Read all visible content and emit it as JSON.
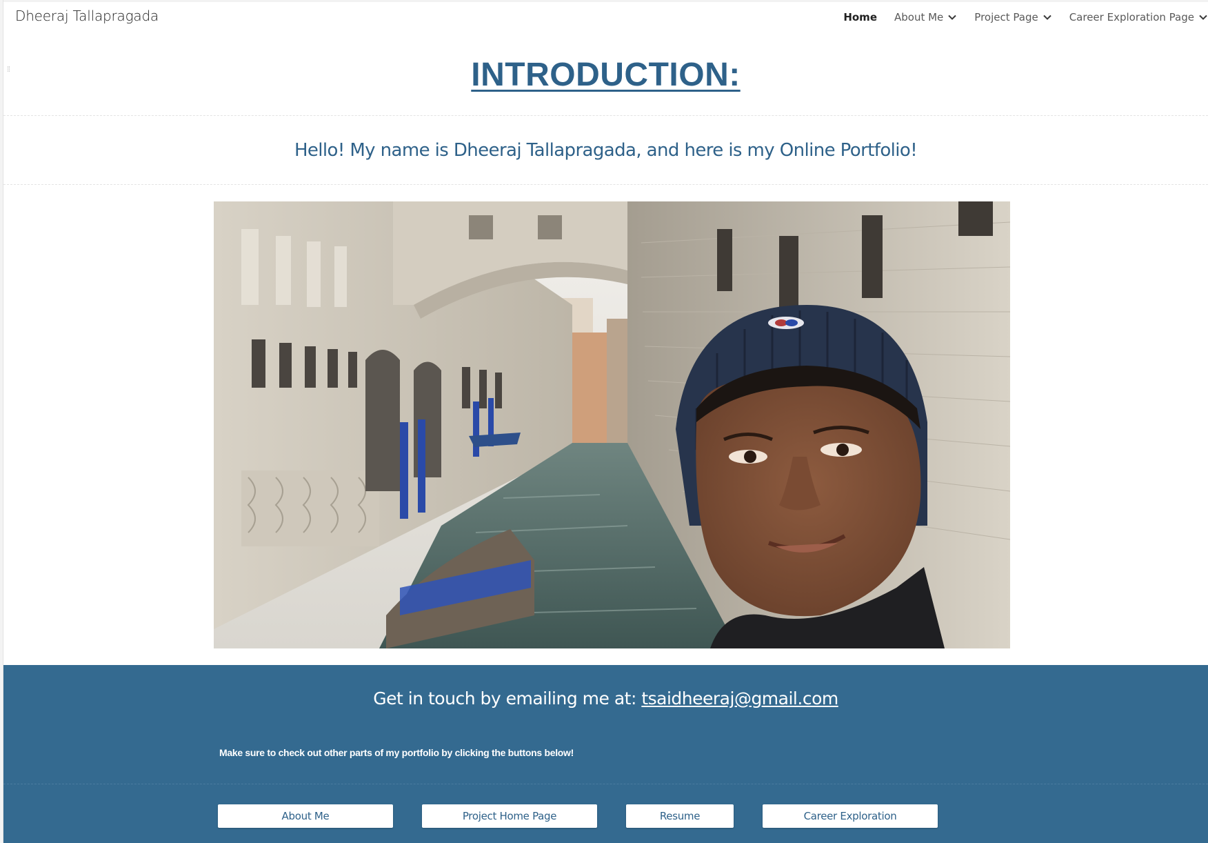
{
  "header": {
    "site_name": "Dheeraj Tallapragada",
    "nav": [
      {
        "label": "Home",
        "active": true,
        "has_dropdown": false
      },
      {
        "label": "About Me",
        "active": false,
        "has_dropdown": true
      },
      {
        "label": "Project Page",
        "active": false,
        "has_dropdown": true
      },
      {
        "label": "Career Exploration Page",
        "active": false,
        "has_dropdown": true
      }
    ]
  },
  "intro": {
    "title": "INTRODUCTION:"
  },
  "hello": {
    "text": "Hello! My name is Dheeraj Tallapragada, and here is my Online Portfolio!"
  },
  "photo": {
    "icon": "photo-venice-canal-selfie"
  },
  "footer": {
    "contact_prefix": "Get in touch by emailing me at: ",
    "email": "tsaidheeraj@gmail.com",
    "note": "Make sure to check out other parts of my portfolio by clicking the buttons below!",
    "buttons": [
      {
        "label": "About Me"
      },
      {
        "label": "Project Home Page"
      },
      {
        "label": "Resume"
      },
      {
        "label": "Career Exploration"
      }
    ]
  },
  "colors": {
    "accent": "#2e6189",
    "footer_bg": "#346a90",
    "text_dark": "#212121",
    "nav_text": "#595959"
  }
}
